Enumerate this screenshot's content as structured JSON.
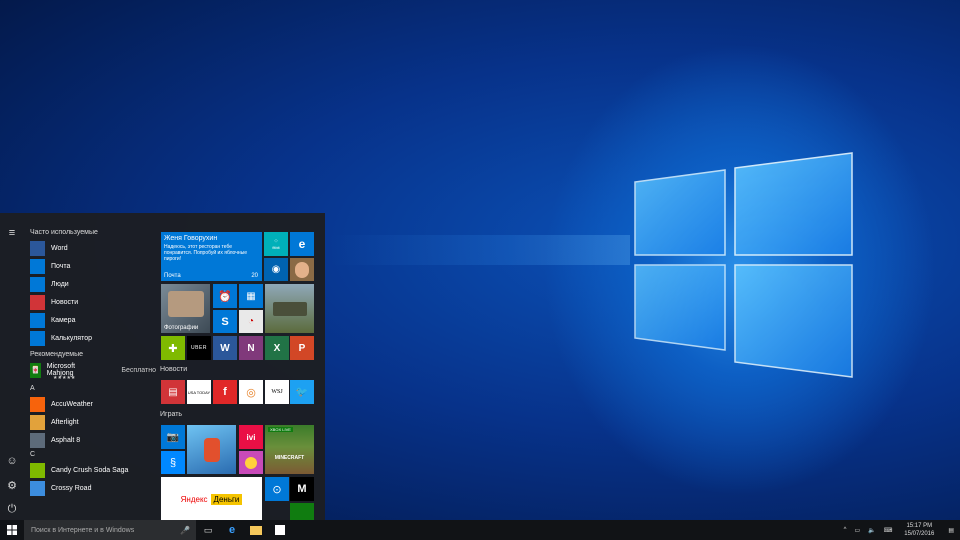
{
  "start_menu": {
    "frequent_header": "Часто используемые",
    "frequent": [
      {
        "label": "Word",
        "icon": "word-icon",
        "color": "#2b579a"
      },
      {
        "label": "Почта",
        "icon": "mail-icon",
        "color": "#0078d7"
      },
      {
        "label": "Люди",
        "icon": "people-icon",
        "color": "#0078d7"
      },
      {
        "label": "Новости",
        "icon": "news-icon",
        "color": "#d13438"
      },
      {
        "label": "Камера",
        "icon": "camera-icon",
        "color": "#0078d7"
      },
      {
        "label": "Калькулятор",
        "icon": "calculator-icon",
        "color": "#0078d7"
      }
    ],
    "recommended_header": "Рекомендуемые",
    "recommended": {
      "label": "Microsoft Mahjong",
      "sub": "Бесплатно",
      "stars": "★★★★★"
    },
    "letter_a": "A",
    "apps_a": [
      {
        "label": "AccuWeather",
        "icon": "sun-icon",
        "color": "#f7630c"
      },
      {
        "label": "Afterlight",
        "icon": "afterlight-icon",
        "color": "#e2a23b"
      },
      {
        "label": "Asphalt 8",
        "icon": "car-icon",
        "color": "#5d6b7a"
      }
    ],
    "letter_c": "C",
    "apps_c": [
      {
        "label": "Candy Crush Soda Saga",
        "icon": "candy-icon",
        "color": "#7fba00"
      },
      {
        "label": "Crossy Road",
        "icon": "chicken-icon",
        "color": "#3c8dde"
      }
    ],
    "tiles": {
      "mail_tile": {
        "name": "Женя Говорухин",
        "text": "Надеюсь, этот ресторан тебе понравится. Попробуй их яблочные пироги!",
        "caption": "Почта",
        "count": "20"
      },
      "fitbit_label": "fitbit",
      "photos_caption": "Фотографии",
      "uber_label": "UBER",
      "news_group": "Новости",
      "usa_today_label": "USA TODAY",
      "wsj_label": "WSJ",
      "games_group": "Играть",
      "xbox_label": "XBOX LIVE",
      "minecraft_label": "MINECRAFT",
      "ivi_label": "ivi",
      "yandex_label_1": "Яндекс",
      "yandex_label_2": "Деньги",
      "m_label": "M"
    }
  },
  "taskbar": {
    "search_placeholder": "Поиск в Интернете и в Windows",
    "time": "15:17 PM",
    "date": "15/07/2016"
  }
}
